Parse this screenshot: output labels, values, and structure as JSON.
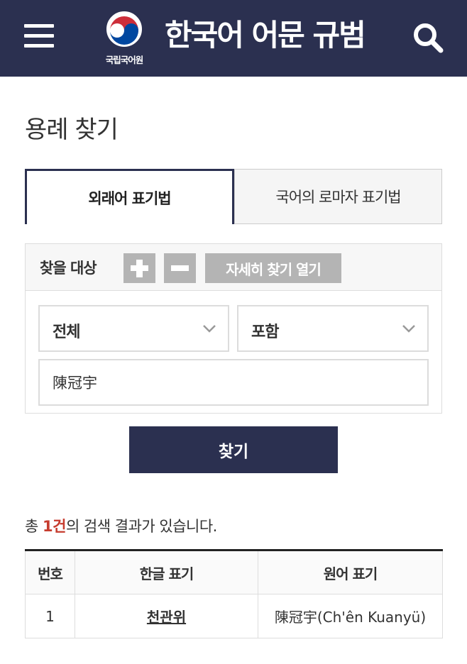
{
  "header": {
    "menu_icon": "hamburger-menu-icon",
    "logo_text": "국립국어원",
    "logo_icon": "taegeuk-emblem",
    "title": "한국어 어문 규범",
    "search_icon": "search-icon"
  },
  "page": {
    "title": "용례 찾기"
  },
  "tabs": [
    {
      "label": "외래어 표기법",
      "active": true
    },
    {
      "label": "국어의 로마자 표기법",
      "active": false
    }
  ],
  "search": {
    "target_label": "찾을 대상",
    "add_icon": "plus-icon",
    "remove_icon": "minus-icon",
    "detail_button": "자세히 찾기 열기",
    "field_select": "전체",
    "match_select": "포함",
    "query": "陳冠宇",
    "submit_label": "찾기"
  },
  "results": {
    "prefix": "총 ",
    "count": "1건",
    "suffix": "의 검색 결과가 있습니다.",
    "columns": [
      "번호",
      "한글 표기",
      "원어 표기"
    ],
    "rows": [
      {
        "num": "1",
        "korean": "천관위",
        "original": "陳冠宇(Ch'ên Kuanyü)"
      }
    ]
  },
  "colors": {
    "header_bg": "#2b3050",
    "accent_red": "#c63c2e",
    "button_gray": "#b4b4b4"
  }
}
